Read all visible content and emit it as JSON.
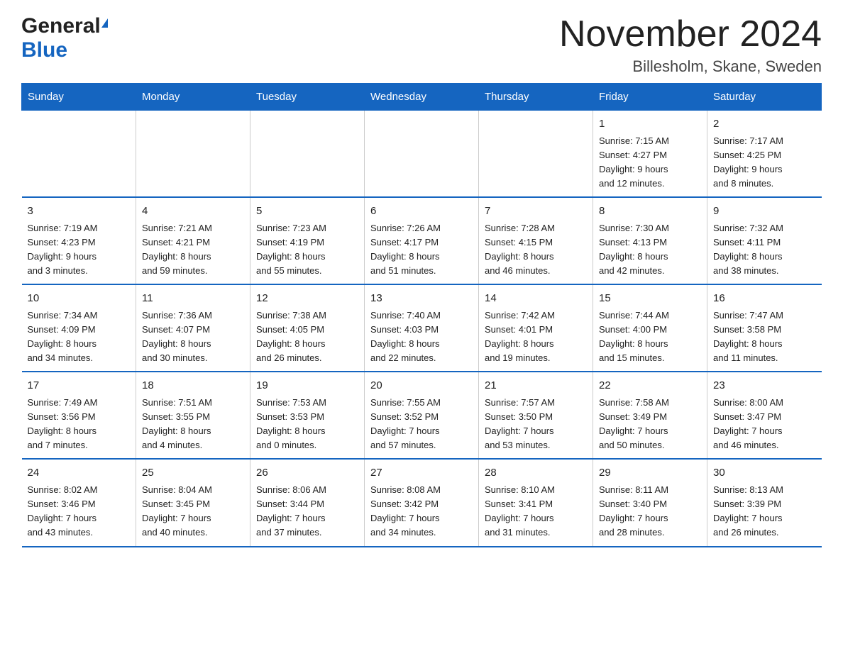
{
  "logo": {
    "general": "General",
    "flag": "",
    "blue": "Blue"
  },
  "header": {
    "title": "November 2024",
    "subtitle": "Billesholm, Skane, Sweden"
  },
  "days_header": [
    "Sunday",
    "Monday",
    "Tuesday",
    "Wednesday",
    "Thursday",
    "Friday",
    "Saturday"
  ],
  "weeks": [
    {
      "days": [
        {
          "date": "",
          "info": ""
        },
        {
          "date": "",
          "info": ""
        },
        {
          "date": "",
          "info": ""
        },
        {
          "date": "",
          "info": ""
        },
        {
          "date": "",
          "info": ""
        },
        {
          "date": "1",
          "info": "Sunrise: 7:15 AM\nSunset: 4:27 PM\nDaylight: 9 hours\nand 12 minutes."
        },
        {
          "date": "2",
          "info": "Sunrise: 7:17 AM\nSunset: 4:25 PM\nDaylight: 9 hours\nand 8 minutes."
        }
      ]
    },
    {
      "days": [
        {
          "date": "3",
          "info": "Sunrise: 7:19 AM\nSunset: 4:23 PM\nDaylight: 9 hours\nand 3 minutes."
        },
        {
          "date": "4",
          "info": "Sunrise: 7:21 AM\nSunset: 4:21 PM\nDaylight: 8 hours\nand 59 minutes."
        },
        {
          "date": "5",
          "info": "Sunrise: 7:23 AM\nSunset: 4:19 PM\nDaylight: 8 hours\nand 55 minutes."
        },
        {
          "date": "6",
          "info": "Sunrise: 7:26 AM\nSunset: 4:17 PM\nDaylight: 8 hours\nand 51 minutes."
        },
        {
          "date": "7",
          "info": "Sunrise: 7:28 AM\nSunset: 4:15 PM\nDaylight: 8 hours\nand 46 minutes."
        },
        {
          "date": "8",
          "info": "Sunrise: 7:30 AM\nSunset: 4:13 PM\nDaylight: 8 hours\nand 42 minutes."
        },
        {
          "date": "9",
          "info": "Sunrise: 7:32 AM\nSunset: 4:11 PM\nDaylight: 8 hours\nand 38 minutes."
        }
      ]
    },
    {
      "days": [
        {
          "date": "10",
          "info": "Sunrise: 7:34 AM\nSunset: 4:09 PM\nDaylight: 8 hours\nand 34 minutes."
        },
        {
          "date": "11",
          "info": "Sunrise: 7:36 AM\nSunset: 4:07 PM\nDaylight: 8 hours\nand 30 minutes."
        },
        {
          "date": "12",
          "info": "Sunrise: 7:38 AM\nSunset: 4:05 PM\nDaylight: 8 hours\nand 26 minutes."
        },
        {
          "date": "13",
          "info": "Sunrise: 7:40 AM\nSunset: 4:03 PM\nDaylight: 8 hours\nand 22 minutes."
        },
        {
          "date": "14",
          "info": "Sunrise: 7:42 AM\nSunset: 4:01 PM\nDaylight: 8 hours\nand 19 minutes."
        },
        {
          "date": "15",
          "info": "Sunrise: 7:44 AM\nSunset: 4:00 PM\nDaylight: 8 hours\nand 15 minutes."
        },
        {
          "date": "16",
          "info": "Sunrise: 7:47 AM\nSunset: 3:58 PM\nDaylight: 8 hours\nand 11 minutes."
        }
      ]
    },
    {
      "days": [
        {
          "date": "17",
          "info": "Sunrise: 7:49 AM\nSunset: 3:56 PM\nDaylight: 8 hours\nand 7 minutes."
        },
        {
          "date": "18",
          "info": "Sunrise: 7:51 AM\nSunset: 3:55 PM\nDaylight: 8 hours\nand 4 minutes."
        },
        {
          "date": "19",
          "info": "Sunrise: 7:53 AM\nSunset: 3:53 PM\nDaylight: 8 hours\nand 0 minutes."
        },
        {
          "date": "20",
          "info": "Sunrise: 7:55 AM\nSunset: 3:52 PM\nDaylight: 7 hours\nand 57 minutes."
        },
        {
          "date": "21",
          "info": "Sunrise: 7:57 AM\nSunset: 3:50 PM\nDaylight: 7 hours\nand 53 minutes."
        },
        {
          "date": "22",
          "info": "Sunrise: 7:58 AM\nSunset: 3:49 PM\nDaylight: 7 hours\nand 50 minutes."
        },
        {
          "date": "23",
          "info": "Sunrise: 8:00 AM\nSunset: 3:47 PM\nDaylight: 7 hours\nand 46 minutes."
        }
      ]
    },
    {
      "days": [
        {
          "date": "24",
          "info": "Sunrise: 8:02 AM\nSunset: 3:46 PM\nDaylight: 7 hours\nand 43 minutes."
        },
        {
          "date": "25",
          "info": "Sunrise: 8:04 AM\nSunset: 3:45 PM\nDaylight: 7 hours\nand 40 minutes."
        },
        {
          "date": "26",
          "info": "Sunrise: 8:06 AM\nSunset: 3:44 PM\nDaylight: 7 hours\nand 37 minutes."
        },
        {
          "date": "27",
          "info": "Sunrise: 8:08 AM\nSunset: 3:42 PM\nDaylight: 7 hours\nand 34 minutes."
        },
        {
          "date": "28",
          "info": "Sunrise: 8:10 AM\nSunset: 3:41 PM\nDaylight: 7 hours\nand 31 minutes."
        },
        {
          "date": "29",
          "info": "Sunrise: 8:11 AM\nSunset: 3:40 PM\nDaylight: 7 hours\nand 28 minutes."
        },
        {
          "date": "30",
          "info": "Sunrise: 8:13 AM\nSunset: 3:39 PM\nDaylight: 7 hours\nand 26 minutes."
        }
      ]
    }
  ]
}
